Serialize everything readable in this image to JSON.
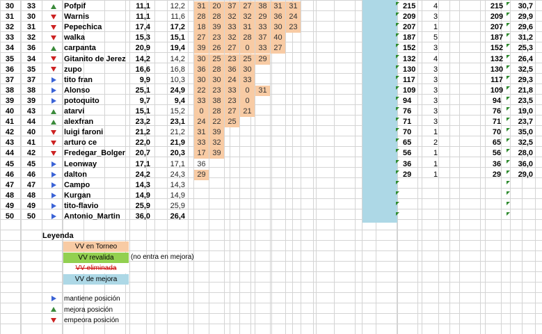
{
  "rows": [
    {
      "pos": "30",
      "prev": "33",
      "ind": "up",
      "name": "Pofpif",
      "a": "11,1",
      "b": "12,2",
      "bb": false,
      "vv": [
        "31",
        "20",
        "37",
        "27",
        "38",
        "31",
        "31"
      ],
      "tot": "215",
      "cnt": "4",
      "tot2": "215",
      "avg": "30,7"
    },
    {
      "pos": "31",
      "prev": "30",
      "ind": "down",
      "name": "Warnis",
      "a": "11,1",
      "b": "11,6",
      "bb": false,
      "vv": [
        "28",
        "28",
        "32",
        "32",
        "29",
        "36",
        "24"
      ],
      "tot": "209",
      "cnt": "3",
      "tot2": "209",
      "avg": "29,9"
    },
    {
      "pos": "32",
      "prev": "31",
      "ind": "down",
      "name": "Pepechica",
      "a": "17,4",
      "b": "17,2",
      "bb": true,
      "vv": [
        "18",
        "39",
        "33",
        "31",
        "33",
        "30",
        "23"
      ],
      "tot": "207",
      "cnt": "1",
      "tot2": "207",
      "avg": "29,6"
    },
    {
      "pos": "33",
      "prev": "32",
      "ind": "down",
      "name": "walka",
      "a": "15,3",
      "b": "15,1",
      "bb": true,
      "vv": [
        "27",
        "23",
        "32",
        "28",
        "37",
        "40"
      ],
      "tot": "187",
      "cnt": "5",
      "tot2": "187",
      "avg": "31,2"
    },
    {
      "pos": "34",
      "prev": "36",
      "ind": "up",
      "name": "carpanta",
      "a": "20,9",
      "b": "19,4",
      "bb": true,
      "vv": [
        "39",
        "26",
        "27",
        "0",
        "33",
        "27"
      ],
      "tot": "152",
      "cnt": "3",
      "tot2": "152",
      "avg": "25,3"
    },
    {
      "pos": "35",
      "prev": "34",
      "ind": "down",
      "name": "Gitanito de Jerez",
      "a": "14,2",
      "b": "14,2",
      "bb": false,
      "vv": [
        "30",
        "25",
        "23",
        "25",
        "29"
      ],
      "tot": "132",
      "cnt": "4",
      "tot2": "132",
      "avg": "26,4"
    },
    {
      "pos": "36",
      "prev": "35",
      "ind": "down",
      "name": "zupo",
      "a": "16,6",
      "b": "16,8",
      "bb": false,
      "vv": [
        "36",
        "28",
        "36",
        "30"
      ],
      "tot": "130",
      "cnt": "3",
      "tot2": "130",
      "avg": "32,5"
    },
    {
      "pos": "37",
      "prev": "37",
      "ind": "same",
      "name": "tito fran",
      "a": "9,9",
      "b": "10,3",
      "bb": false,
      "vv": [
        "30",
        "30",
        "24",
        "33"
      ],
      "tot": "117",
      "cnt": "3",
      "tot2": "117",
      "avg": "29,3"
    },
    {
      "pos": "38",
      "prev": "38",
      "ind": "same",
      "name": "Alonso",
      "a": "25,1",
      "b": "24,9",
      "bb": true,
      "vv": [
        "22",
        "23",
        "33",
        "0",
        "31"
      ],
      "tot": "109",
      "cnt": "3",
      "tot2": "109",
      "avg": "21,8"
    },
    {
      "pos": "39",
      "prev": "39",
      "ind": "same",
      "name": "potoquito",
      "a": "9,7",
      "b": "9,4",
      "bb": true,
      "vv": [
        "33",
        "38",
        "23",
        "0"
      ],
      "tot": "94",
      "cnt": "3",
      "tot2": "94",
      "avg": "23,5"
    },
    {
      "pos": "40",
      "prev": "43",
      "ind": "up",
      "name": "atarvi",
      "a": "15,1",
      "b": "15,2",
      "bb": false,
      "vv": [
        "0",
        "28",
        "27",
        "21"
      ],
      "tot": "76",
      "cnt": "3",
      "tot2": "76",
      "avg": "19,0"
    },
    {
      "pos": "41",
      "prev": "44",
      "ind": "up",
      "name": "alexfran",
      "a": "23,2",
      "b": "23,1",
      "bb": true,
      "vv": [
        "24",
        "22",
        "25"
      ],
      "tot": "71",
      "cnt": "3",
      "tot2": "71",
      "avg": "23,7"
    },
    {
      "pos": "42",
      "prev": "40",
      "ind": "down",
      "name": "luigi faroni",
      "a": "21,2",
      "b": "21,2",
      "bb": false,
      "vv": [
        "31",
        "39"
      ],
      "tot": "70",
      "cnt": "1",
      "tot2": "70",
      "avg": "35,0"
    },
    {
      "pos": "43",
      "prev": "41",
      "ind": "down",
      "name": "arturo ce",
      "a": "22,0",
      "b": "21,9",
      "bb": true,
      "vv": [
        "33",
        "32"
      ],
      "tot": "65",
      "cnt": "2",
      "tot2": "65",
      "avg": "32,5"
    },
    {
      "pos": "44",
      "prev": "42",
      "ind": "down",
      "name": "Fredegar_Bolger",
      "a": "20,7",
      "b": "20,3",
      "bb": true,
      "vv": [
        "17",
        "39"
      ],
      "tot": "56",
      "cnt": "1",
      "tot2": "56",
      "avg": "28,0"
    },
    {
      "pos": "45",
      "prev": "45",
      "ind": "same",
      "name": "Leonway",
      "a": "17,1",
      "b": "17,1",
      "bb": false,
      "vv": [
        "36"
      ],
      "vvplain": true,
      "tot": "36",
      "cnt": "1",
      "tot2": "36",
      "avg": "36,0"
    },
    {
      "pos": "46",
      "prev": "46",
      "ind": "same",
      "name": "dalton",
      "a": "24,2",
      "b": "24,3",
      "bb": false,
      "vv": [
        "29"
      ],
      "tot": "29",
      "cnt": "1",
      "tot2": "29",
      "avg": "29,0"
    },
    {
      "pos": "47",
      "prev": "47",
      "ind": "same",
      "name": "Campo",
      "a": "14,3",
      "b": "14,3",
      "bb": false,
      "vv": [],
      "tot": "",
      "cnt": "",
      "tot2": "",
      "avg": ""
    },
    {
      "pos": "48",
      "prev": "48",
      "ind": "same",
      "name": "Kurgan",
      "a": "14,9",
      "b": "14,9",
      "bb": false,
      "vv": [],
      "tot": "",
      "cnt": "",
      "tot2": "",
      "avg": ""
    },
    {
      "pos": "49",
      "prev": "49",
      "ind": "same",
      "name": "tito-flavio",
      "a": "25,9",
      "b": "25,9",
      "bb": false,
      "vv": [],
      "tot": "",
      "cnt": "",
      "tot2": "",
      "avg": ""
    },
    {
      "pos": "50",
      "prev": "50",
      "ind": "same",
      "name": "Antonio_Martin",
      "a": "36,0",
      "b": "26,4",
      "bb": true,
      "vv": [],
      "tot": "",
      "cnt": "",
      "tot2": "",
      "avg": ""
    }
  ],
  "legend": {
    "title": "Leyenda",
    "items": [
      {
        "label": "VV en Torneo",
        "color": "#f8cba4",
        "note": ""
      },
      {
        "label": "VV revalida",
        "color": "#92d050",
        "note": "(no entra en mejora)"
      },
      {
        "label": "VV eliminada",
        "color": "#ffffff",
        "note": "",
        "strike": true
      },
      {
        "label": "VV de mejora",
        "color": "#add8e6",
        "note": ""
      }
    ],
    "indicators": [
      {
        "icon": "same",
        "label": "mantiene posición"
      },
      {
        "icon": "up",
        "label": "mejora posición"
      },
      {
        "icon": "down",
        "label": "empeora posición"
      }
    ]
  },
  "colors": {
    "vv_torneo": "#f8cba4",
    "vv_revalida": "#92d050",
    "vv_mejora": "#add8e6",
    "up": "#3a8a3a",
    "down": "#cc2222",
    "same": "#3b63d6"
  }
}
